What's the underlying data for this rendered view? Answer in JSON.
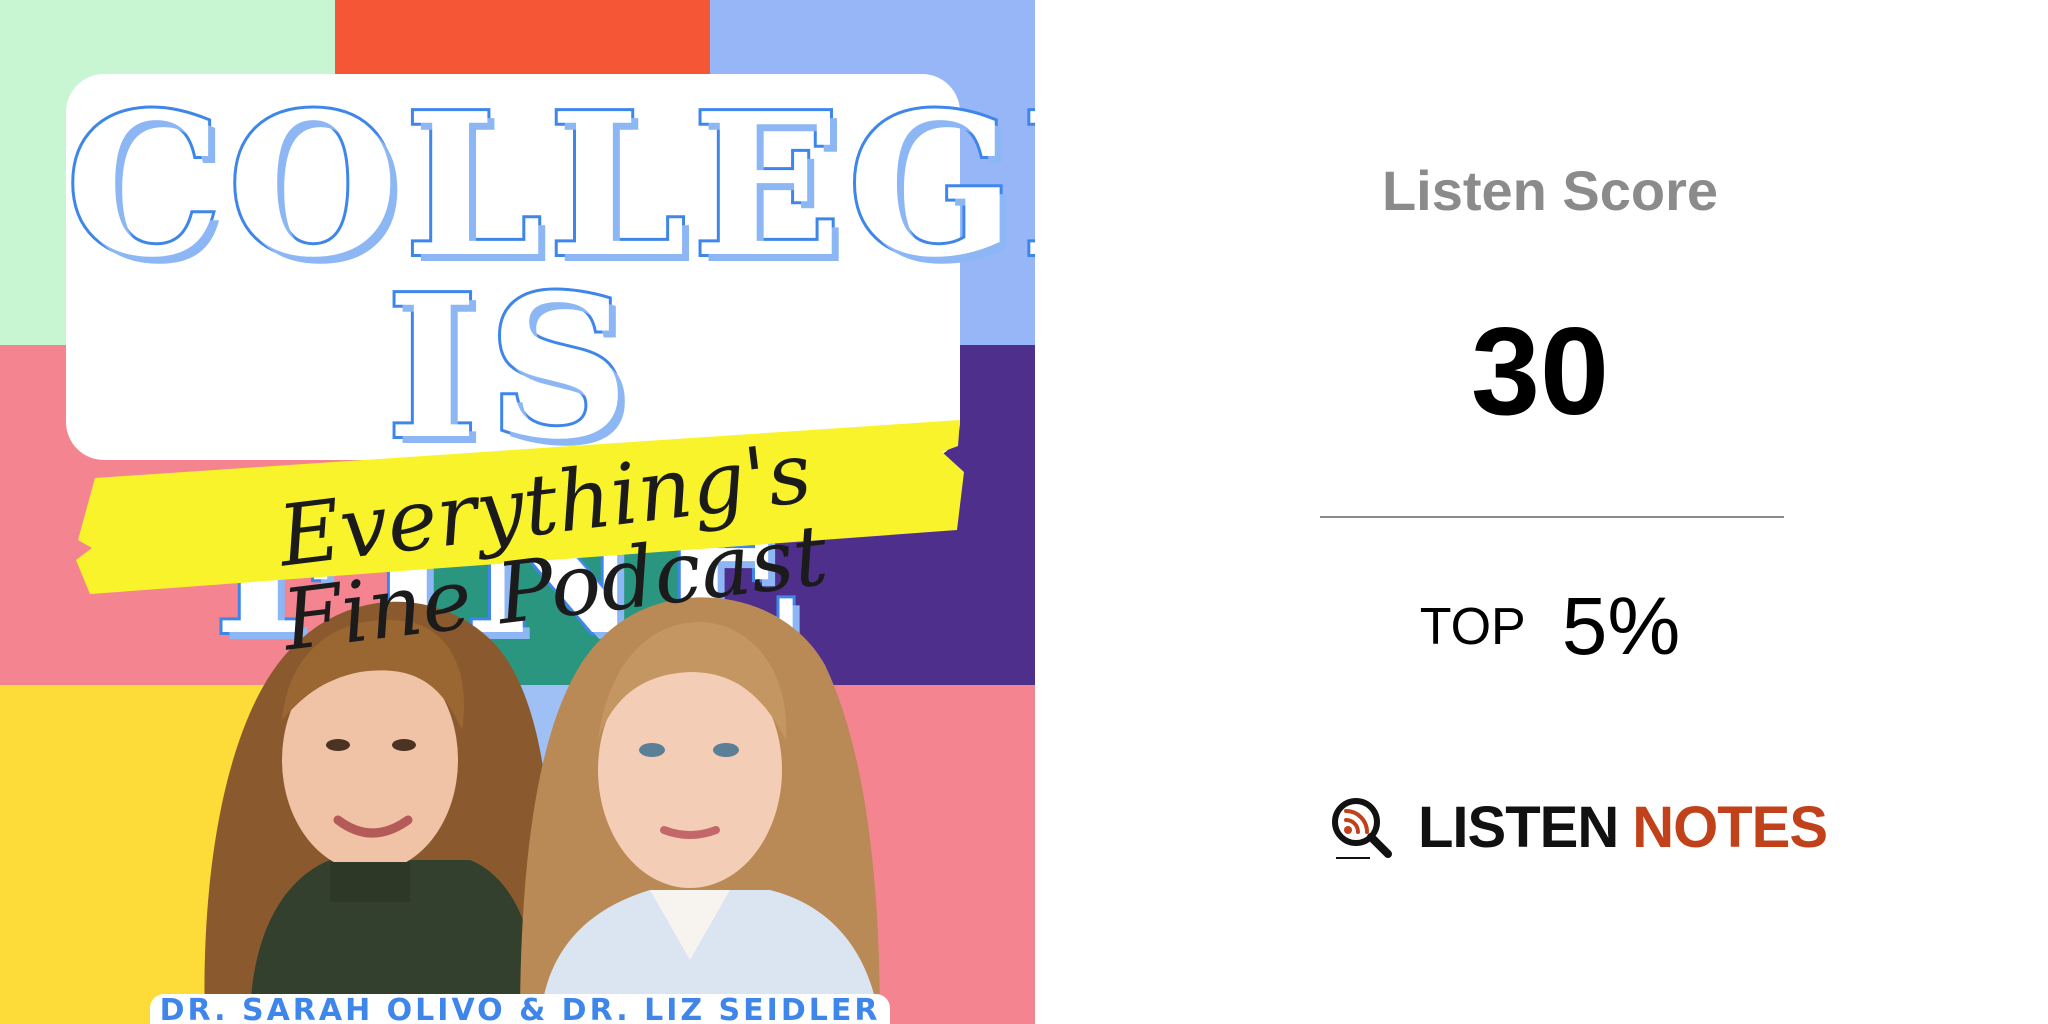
{
  "cover": {
    "title_line1": "COLLEGE",
    "title_line2": "IS FINE",
    "tagline": "Everything's Fine Podcast",
    "hosts": "DR. SARAH OLIVO & DR. LIZ SEIDLER",
    "colors": {
      "mint": "#c8f5d2",
      "orange": "#f55636",
      "periwinkle": "#97b6f8",
      "pink": "#f48590",
      "purple": "#4e2f8c",
      "teal": "#2a9680",
      "yellow": "#fddc3a",
      "title_blue": "#3f86ea",
      "highlight_yellow": "#f8f32a"
    }
  },
  "score_panel": {
    "label": "Listen Score",
    "value": "30",
    "rank_prefix": "TOP",
    "rank_value": "5%"
  },
  "brand": {
    "word1": "LISTEN",
    "word2": "NOTES",
    "icon": "magnifier-rss-icon",
    "accent_color": "#c0411a"
  }
}
